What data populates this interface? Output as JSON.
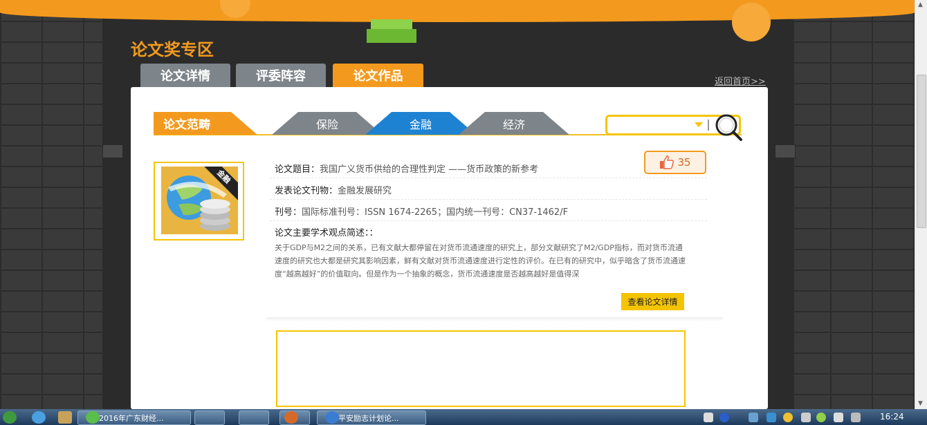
{
  "header": {
    "section_title": "论文奖专区",
    "home_link": "返回首页>>"
  },
  "main_tabs": [
    {
      "label": "论文详情",
      "active": false
    },
    {
      "label": "评委阵容",
      "active": false
    },
    {
      "label": "论文作品",
      "active": true
    }
  ],
  "category": {
    "label": "论文范畴",
    "tabs": [
      {
        "label": "保险",
        "active": false
      },
      {
        "label": "金融",
        "active": true
      },
      {
        "label": "经济",
        "active": false
      }
    ]
  },
  "search": {
    "placeholder": ""
  },
  "paper": {
    "thumb_badge": "金融",
    "title_label": "论文题目：",
    "title_value": "我国广义货币供给的合理性判定 ——货币政策的新参考",
    "journal_label": "发表论文刊物：",
    "journal_value": "金融发展研究",
    "issue_label": "刊号：",
    "issue_value": "国际标准刊号：ISSN 1674-2265；国内统一刊号：CN37-1462/F",
    "abstract_label": "论文主要学术观点简述：：",
    "abstract_text": "关于GDP与M2之间的关系，已有文献大都停留在对货币流通速度的研究上，部分文献研究了M2/GDP指标，而对货币流通速度的研究也大都是研究其影响因素，鲜有文献对货币流通速度进行定性的评价。在已有的研究中，似乎暗含了货币流通速度“越高越好”的价值取向。但是作为一个抽象的概念，货币流通速度是否越高越好是值得深",
    "likes": "35",
    "detail_button": "查看论文详情"
  },
  "taskbar": {
    "items": [
      {
        "label": "2016年广东财经..."
      },
      {
        "label": ""
      },
      {
        "label": ""
      },
      {
        "label": ""
      },
      {
        "label": "平安励志计划论..."
      }
    ],
    "clock": "16:24"
  },
  "colors": {
    "accent_orange": "#f39a1e",
    "accent_yellow": "#f5c400",
    "active_blue": "#1e82d2",
    "inactive_gray": "#7d848a"
  }
}
